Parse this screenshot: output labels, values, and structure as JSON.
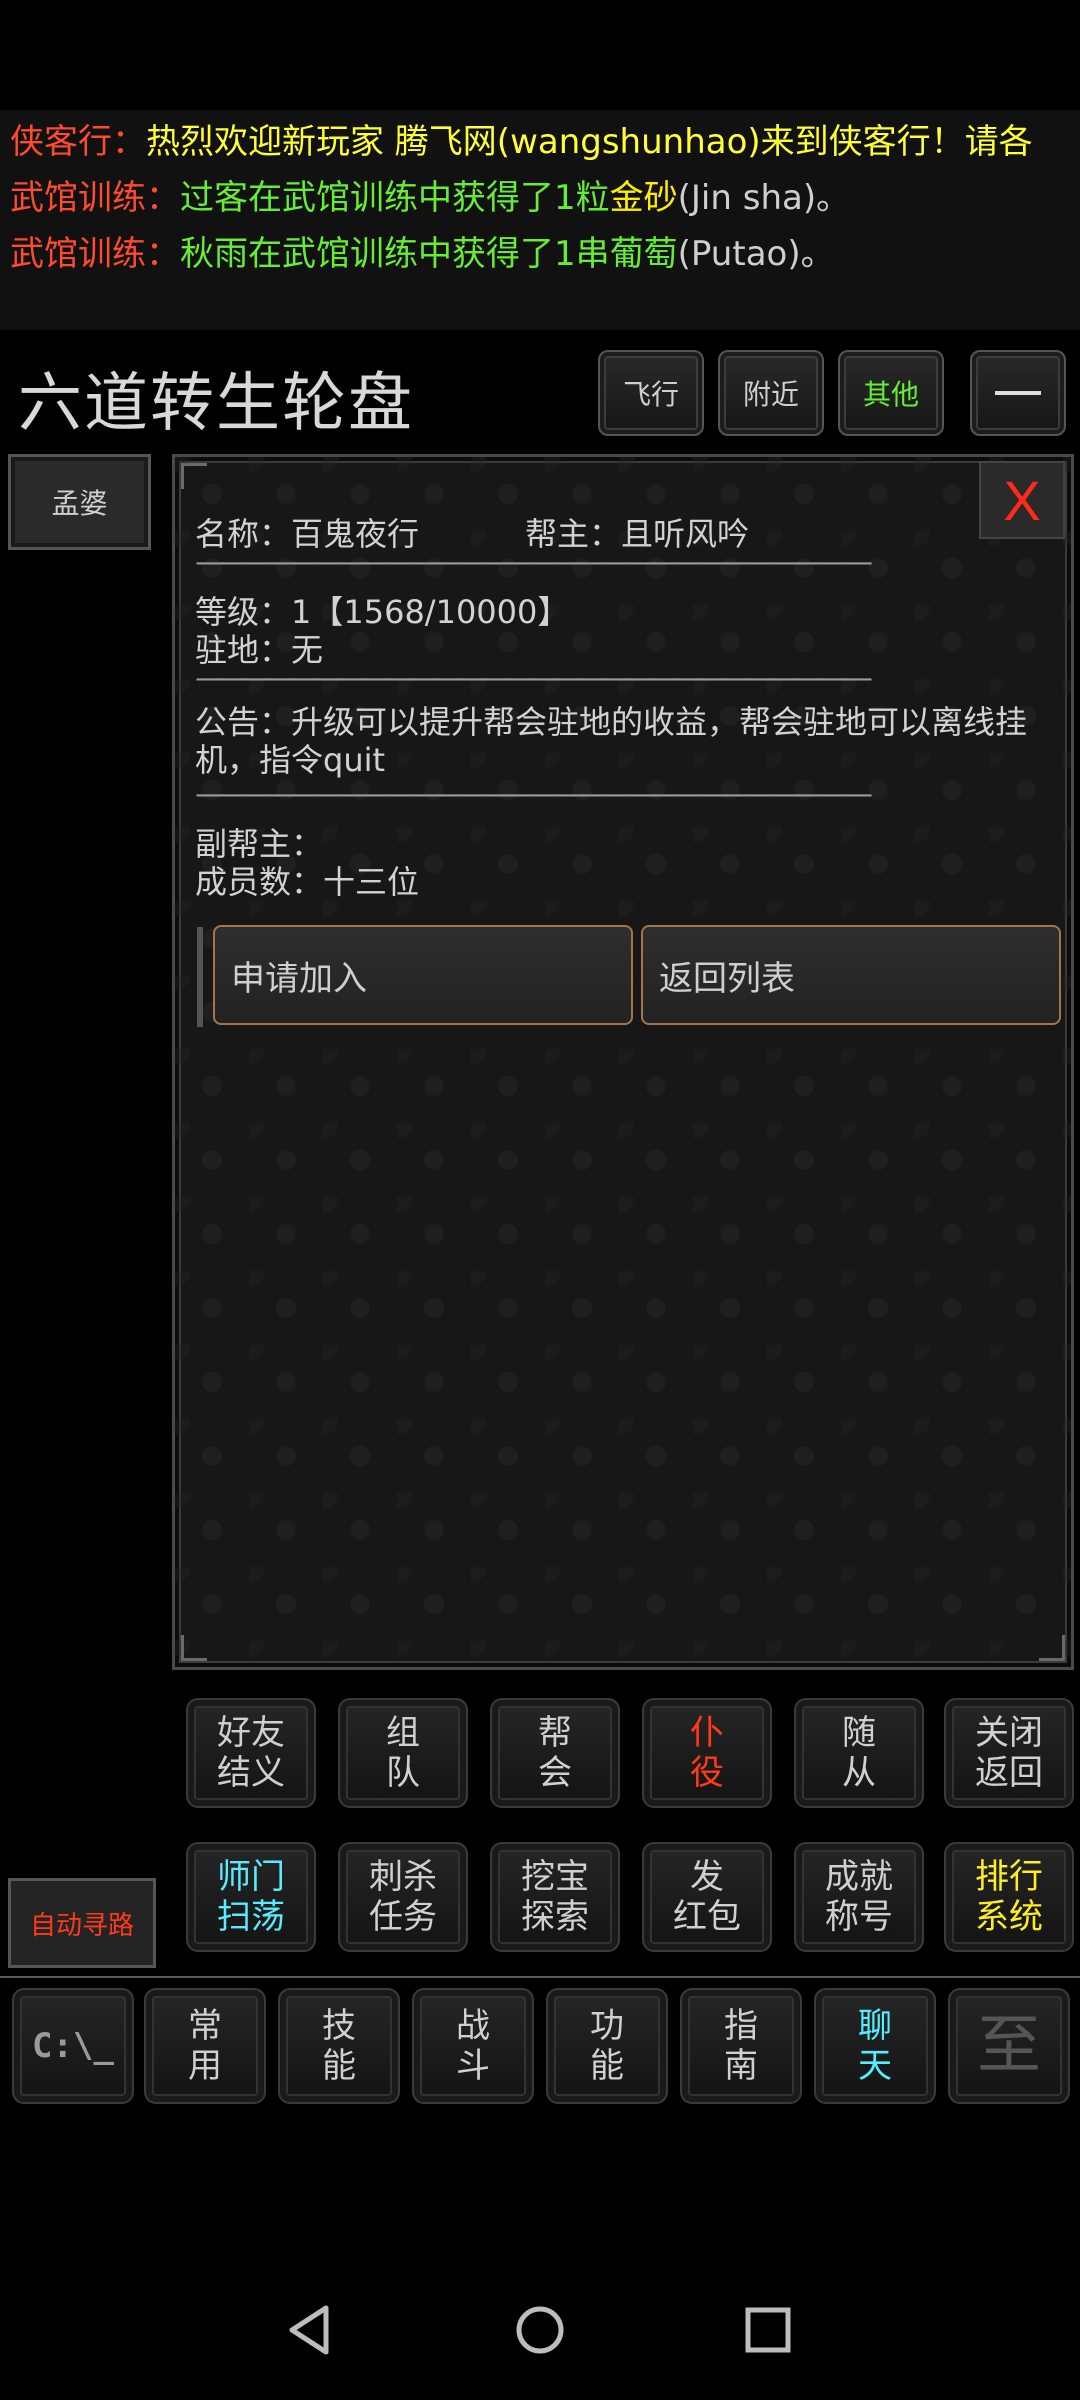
{
  "messages": [
    {
      "channel": "侠客行：",
      "body": "热烈欢迎新玩家  腾飞网(wangshunhao)来到侠客行！请各",
      "item": "",
      "paren": ""
    },
    {
      "channel": "武馆训练：",
      "body": "过客在武馆训练中获得了1粒",
      "item": "金砂",
      "paren": "(Jin sha)。"
    },
    {
      "channel": "武馆训练：",
      "body": "秋雨在武馆训练中获得了1串",
      "item": "葡萄",
      "paren": "(Putao)。"
    }
  ],
  "location": {
    "title": "六道转生轮盘",
    "buttons": {
      "fly": "飞行",
      "nearby": "附近",
      "other": "其他"
    }
  },
  "npc": {
    "name": "孟婆"
  },
  "guild_panel": {
    "close_label": "X",
    "name_line": "名称：百鬼夜行",
    "leader_line": "帮主：且听风吟",
    "divider": "————————————————————————————",
    "level_line": "等级：1【1568/10000】",
    "station_line": "驻地：无",
    "notice_line": "公告：升级可以提升帮会驻地的收益，帮会驻地可以离线挂机，指令quit",
    "vice_leader_line": "副帮主：",
    "members_line": "成员数：十三位",
    "actions": {
      "apply": "申请加入",
      "back": "返回列表"
    }
  },
  "command_rows": [
    [
      {
        "label": "好友\n结义",
        "color": "default"
      },
      {
        "label": "组\n队",
        "color": "default"
      },
      {
        "label": "帮\n会",
        "color": "default"
      },
      {
        "label": "仆\n役",
        "color": "red"
      },
      {
        "label": "随\n从",
        "color": "default"
      },
      {
        "label": "关闭\n返回",
        "color": "default"
      }
    ],
    [
      {
        "label": "师门\n扫荡",
        "color": "cyan"
      },
      {
        "label": "刺杀\n任务",
        "color": "default"
      },
      {
        "label": "挖宝\n探索",
        "color": "default"
      },
      {
        "label": "发\n红包",
        "color": "default"
      },
      {
        "label": "成就\n称号",
        "color": "default"
      },
      {
        "label": "排行\n系统",
        "color": "yellow"
      }
    ]
  ],
  "auto_path_label": "自动寻路",
  "bottom_tabs": {
    "cmdline": "C:\\_",
    "items": [
      {
        "label": "常\n用",
        "color": "default"
      },
      {
        "label": "技\n能",
        "color": "default"
      },
      {
        "label": "战\n斗",
        "color": "default"
      },
      {
        "label": "功\n能",
        "color": "default"
      },
      {
        "label": "指\n南",
        "color": "default"
      },
      {
        "label": "聊\n天",
        "color": "cyan"
      }
    ],
    "emblem": "至"
  }
}
